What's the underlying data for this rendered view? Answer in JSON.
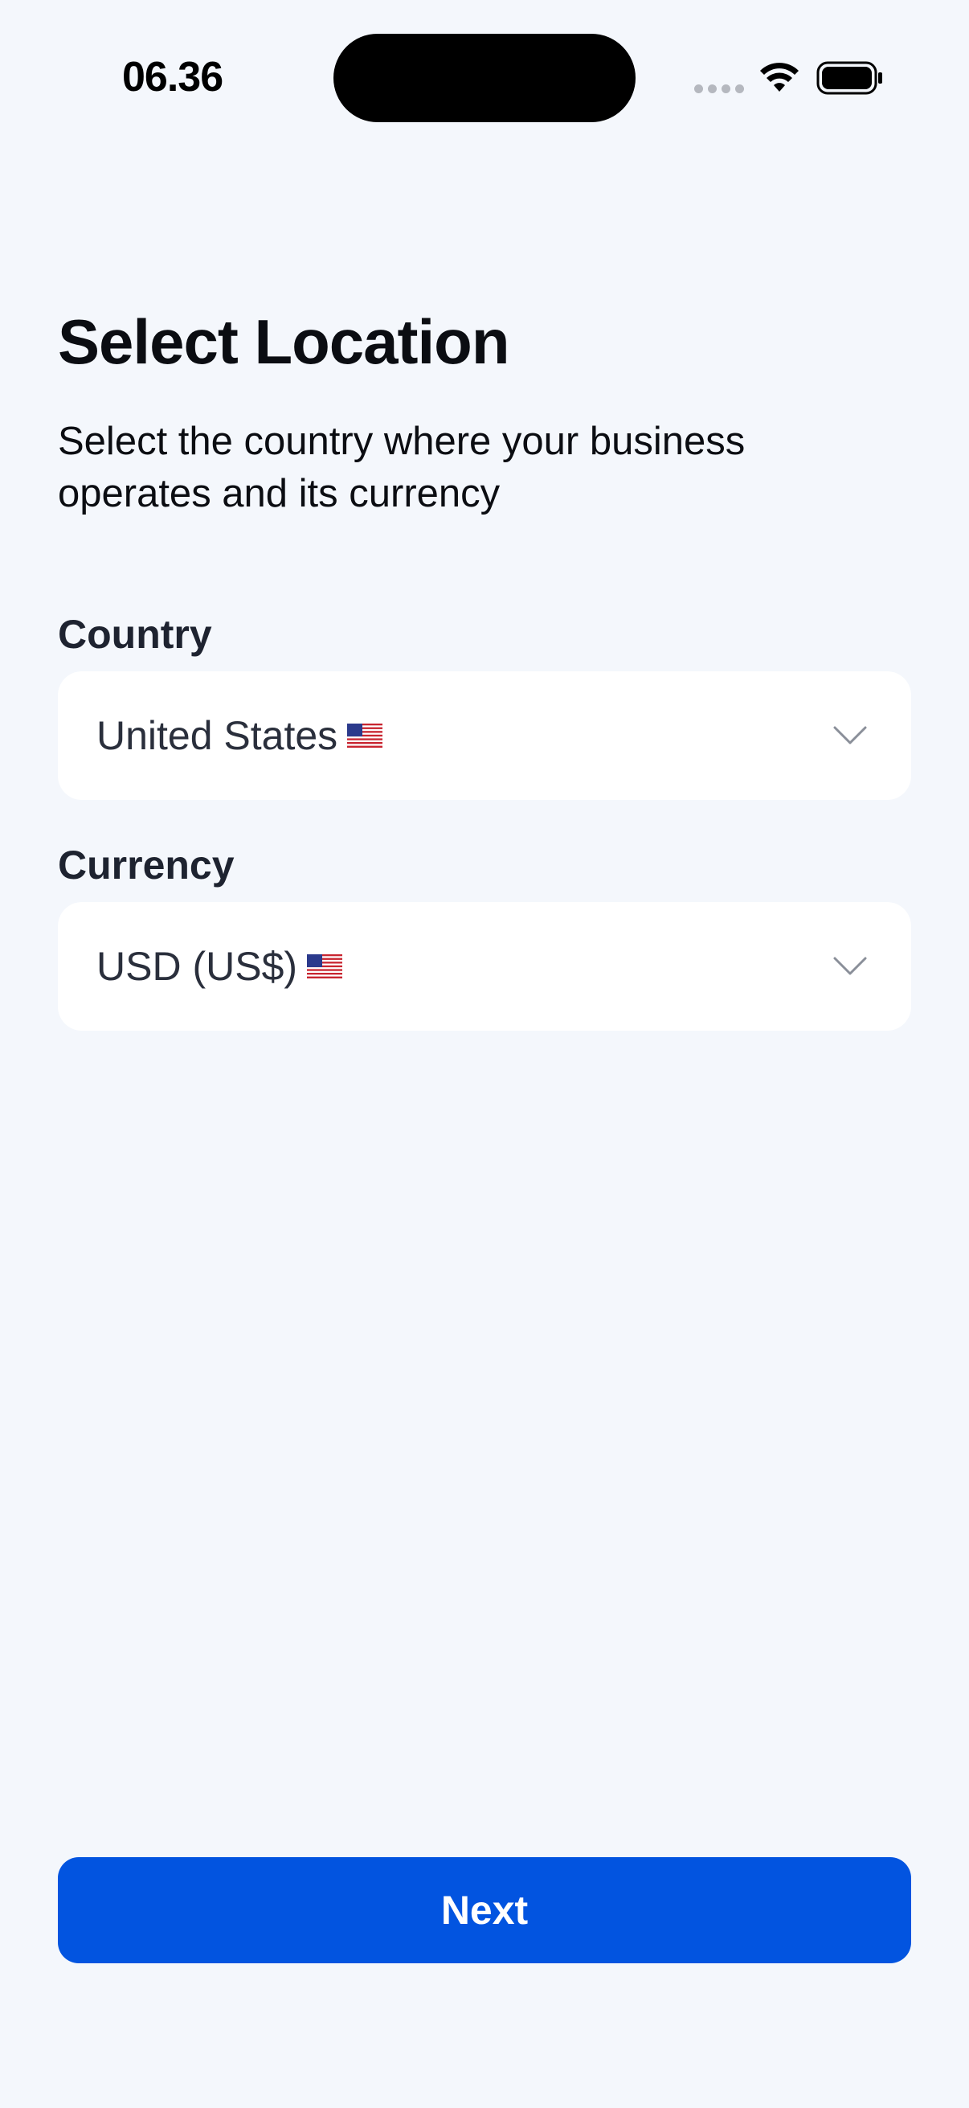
{
  "status_bar": {
    "time": "06.36",
    "icons": [
      "signal-dots-icon",
      "wifi-icon",
      "battery-icon"
    ]
  },
  "header": {
    "title": "Select Location",
    "subtitle": "Select the country where your business operates and its currency"
  },
  "form": {
    "country": {
      "label": "Country",
      "value": "United States",
      "flag_icon": "us-flag-icon"
    },
    "currency": {
      "label": "Currency",
      "value": "USD (US$)",
      "flag_icon": "us-flag-icon"
    }
  },
  "actions": {
    "next_label": "Next"
  },
  "colors": {
    "background": "#f4f7fc",
    "primary": "#0254e0",
    "field_background": "#ffffff",
    "text": "#0b0d12"
  }
}
